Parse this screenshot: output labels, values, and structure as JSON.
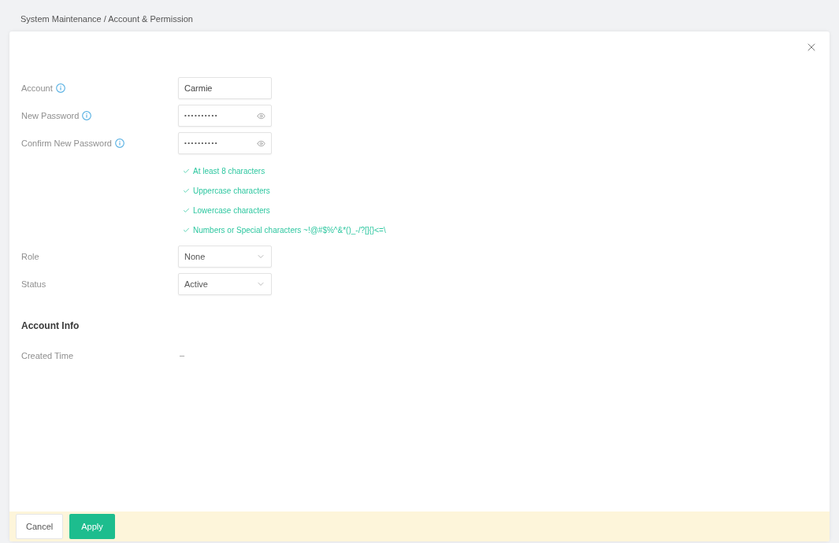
{
  "breadcrumb": "System Maintenance / Account & Permission",
  "form": {
    "fields": [
      {
        "kind": "text",
        "label": "Account",
        "info": true,
        "value": "Carmie"
      },
      {
        "kind": "password",
        "label": "New Password",
        "info": true,
        "value": "••••••••••"
      },
      {
        "kind": "password",
        "label": "Confirm New Password",
        "info": true,
        "value": "••••••••••"
      }
    ],
    "password_rules": [
      {
        "text": "At least 8 characters",
        "met": true
      },
      {
        "text": "Uppercase characters",
        "met": true
      },
      {
        "text": "Lowercase characters",
        "met": true
      },
      {
        "text": "Numbers or Special characters ~!@#$%^&*()_-/?[]{}<=\\",
        "met": true
      }
    ],
    "selects": [
      {
        "label": "Role",
        "value": "None"
      },
      {
        "label": "Status",
        "value": "Active"
      }
    ]
  },
  "account_info": {
    "title": "Account Info",
    "rows": [
      {
        "label": "Created Time",
        "value": "–"
      }
    ]
  },
  "footer": {
    "buttons": [
      {
        "kind": "secondary",
        "label": "Cancel"
      },
      {
        "kind": "primary",
        "label": "Apply"
      }
    ]
  }
}
